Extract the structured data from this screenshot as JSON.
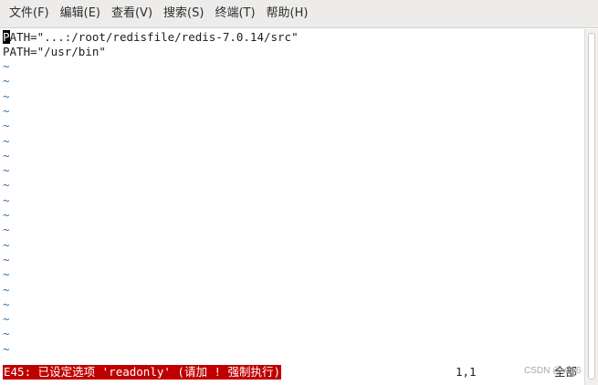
{
  "menubar": {
    "items": [
      {
        "label": "文件(F)"
      },
      {
        "label": "编辑(E)"
      },
      {
        "label": "查看(V)"
      },
      {
        "label": "搜索(S)"
      },
      {
        "label": "终端(T)"
      },
      {
        "label": "帮助(H)"
      }
    ]
  },
  "editor": {
    "lines": [
      {
        "cursor_char": "P",
        "rest": "ATH=\"...:/root/redisfile/redis-7.0.14/src\""
      },
      {
        "text": "PATH=\"/usr/bin\""
      }
    ],
    "empty_line_marker": "~",
    "empty_line_count": 20,
    "colors": {
      "tilde": "#2f6fa8",
      "error_background": "#c00000",
      "error_text": "#ffffff"
    }
  },
  "statusline": {
    "error_message": "E45: 已设定选项 'readonly' (请加 ! 强制执行)",
    "cursor_position": "1,1",
    "scroll_percent": "全部"
  },
  "watermark": {
    "text": "CSDN @v7v6"
  }
}
